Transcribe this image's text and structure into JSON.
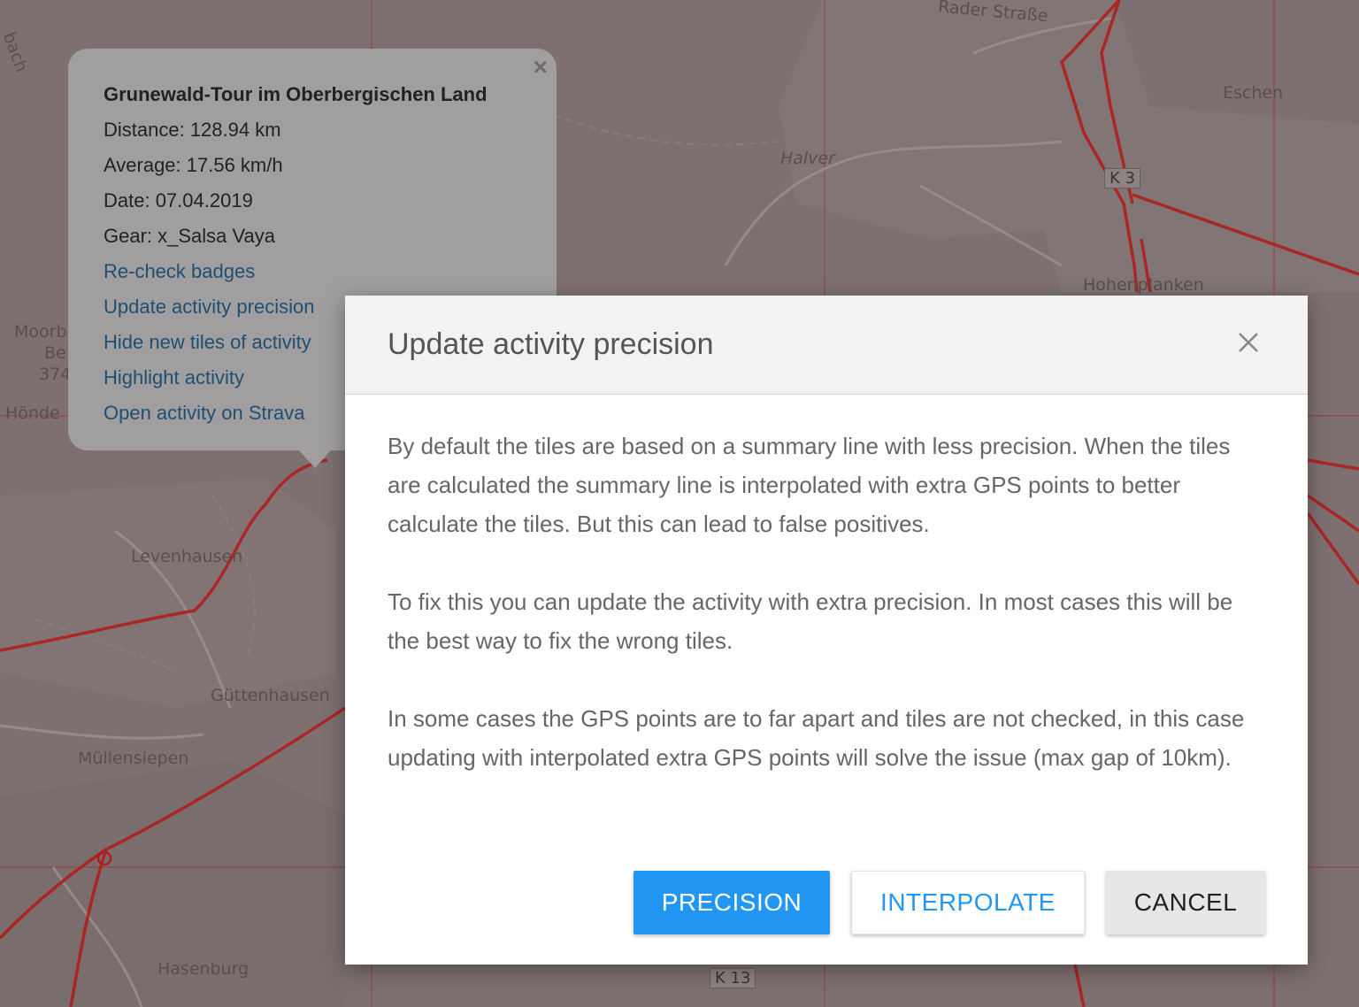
{
  "map": {
    "labels": [
      "Rader Straße",
      "Eschen",
      "Halver",
      "K 3",
      "Hohenplanken",
      "Moorb",
      "Be",
      "374",
      "Hönde",
      "Levenhausen",
      "Güttenhausen",
      "Müllensiepen",
      "Hasenburg",
      "K 13",
      "bach"
    ],
    "route_color": "#b01e1e"
  },
  "popup": {
    "close_glyph": "×",
    "title": "Grunewald-Tour im Oberbergischen Land",
    "distance": "Distance: 128.94 km",
    "average": "Average: 17.56 km/h",
    "date": "Date: 07.04.2019",
    "gear": "Gear: x_Salsa Vaya",
    "links": {
      "recheck": "Re-check badges",
      "update": "Update activity precision",
      "hide": "Hide new tiles of activity",
      "highlight": "Highlight activity",
      "open": "Open activity on Strava"
    }
  },
  "modal": {
    "title": "Update activity precision",
    "paragraphs": [
      "By default the tiles are based on a summary line with less precision. When the tiles are calculated the summary line is interpolated with extra GPS points to better calculate the tiles. But this can lead to false positives.",
      "To fix this you can update the activity with extra precision. In most cases this will be the best way to fix the wrong tiles.",
      "In some cases the GPS points are to far apart and tiles are not checked, in this case updating with interpolated extra GPS points will solve the issue (max gap of 10km)."
    ],
    "buttons": {
      "precision": "PRECISION",
      "interpolate": "INTERPOLATE",
      "cancel": "CANCEL"
    },
    "accent_color": "#2196f3"
  }
}
